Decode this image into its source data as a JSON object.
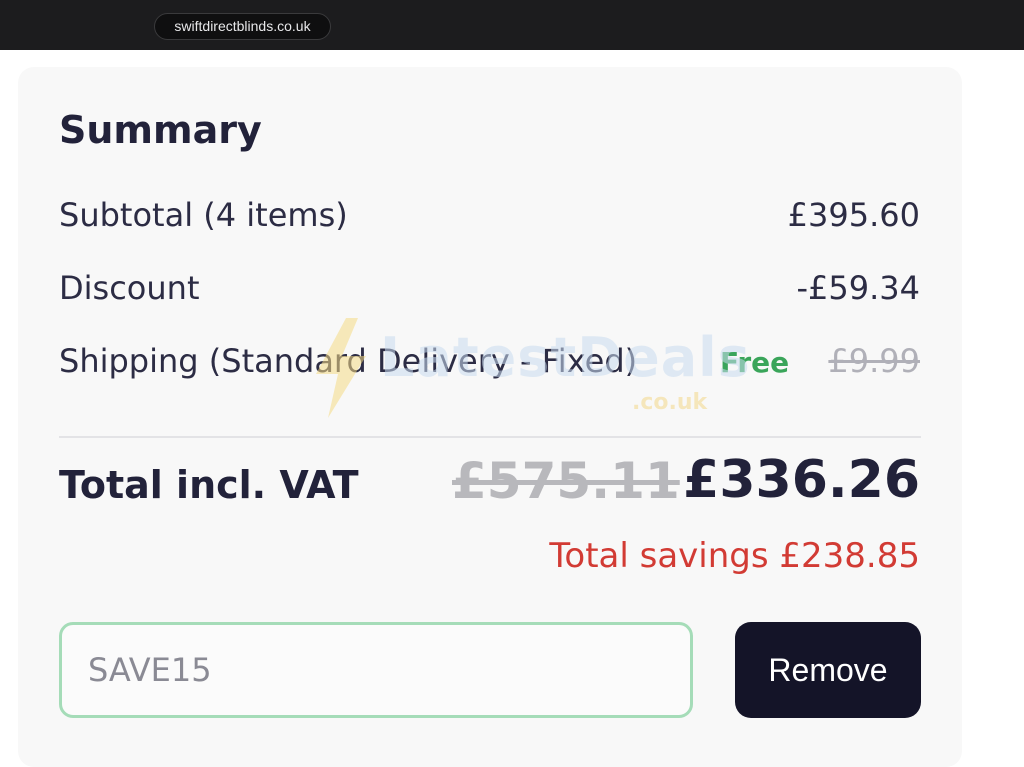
{
  "browser": {
    "url": "swiftdirectblinds.co.uk"
  },
  "summary": {
    "title": "Summary",
    "subtotal_label": "Subtotal (4 items)",
    "subtotal_value": "£395.60",
    "discount_label": "Discount",
    "discount_value": "-£59.34",
    "shipping_label": "Shipping (Standard Delivery - Fixed)",
    "shipping_free": "Free",
    "shipping_original": "£9.99",
    "total_label": "Total incl. VAT",
    "total_original": "£575.11",
    "total_value": "£336.26",
    "savings_text": "Total savings £238.85"
  },
  "coupon": {
    "value": "SAVE15",
    "remove_label": "Remove"
  },
  "watermark": {
    "brand": "LatestDeals",
    "suffix": ".co.uk"
  },
  "colors": {
    "text_primary": "#22223a",
    "free_green": "#3aa55a",
    "savings_red": "#d23b34",
    "button_dark": "#141428",
    "input_border_green": "#a5dcb8"
  }
}
